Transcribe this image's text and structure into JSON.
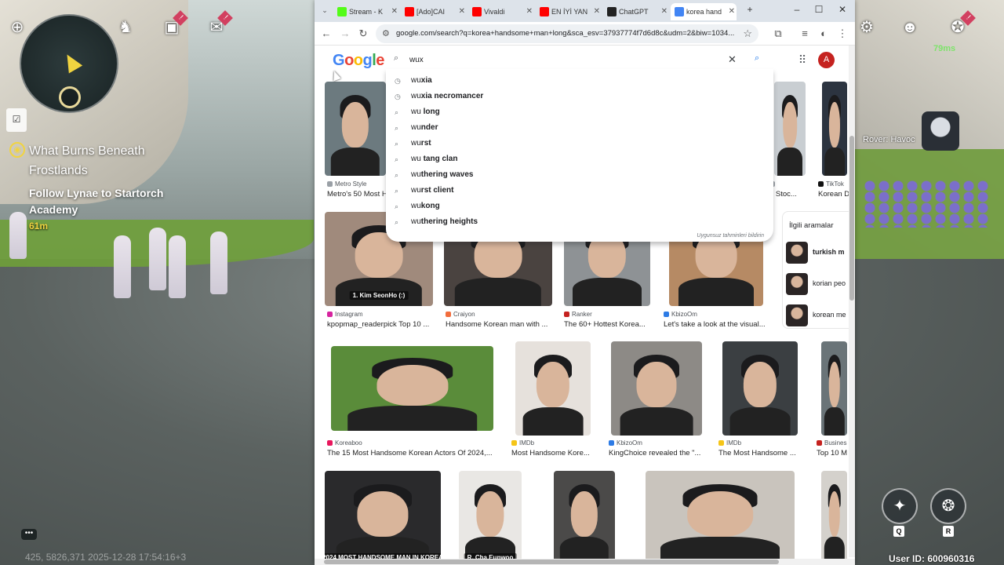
{
  "game": {
    "quest_title": "What Burns Beneath Frostlands",
    "quest_objective": "Follow Lynae to Startorch Academy",
    "quest_distance": "61m",
    "ping": "79ms",
    "character_name": "Rover: Havoc",
    "coords_time": "425, 5826,371   2025-12-28 17:54:16+3",
    "user_id": "User ID: 600960316",
    "skill_keys": [
      "Q",
      "R"
    ],
    "badge": "!"
  },
  "browser": {
    "tabs": [
      {
        "label": "Stream - K",
        "icon": "kick-icon",
        "color": "#53fc18"
      },
      {
        "label": "[Ado]CAI",
        "icon": "youtube-icon",
        "color": "#ff0000"
      },
      {
        "label": "Vivaldi",
        "icon": "youtube-icon",
        "color": "#ff0000"
      },
      {
        "label": "EN İYİ YAN",
        "icon": "youtube-icon",
        "color": "#ff0000"
      },
      {
        "label": "ChatGPT",
        "icon": "chatgpt-icon",
        "color": "#222222"
      },
      {
        "label": "korea hand",
        "icon": "google-icon",
        "color": "#4285f4",
        "active": true
      }
    ],
    "url": "google.com/search?q=korea+handsome+man+long&sca_esv=37937774f7d6d8c&udm=2&biw=1034..."
  },
  "google": {
    "logo": [
      "G",
      "o",
      "o",
      "g",
      "l",
      "e"
    ],
    "account_initial": "A",
    "query": "wux",
    "suggestions": [
      {
        "typed": "wu",
        "rest": "xia",
        "icon": "history-icon"
      },
      {
        "typed": "wu",
        "rest": "xia necromancer",
        "icon": "history-icon"
      },
      {
        "typed": "wu",
        "rest": " long",
        "icon": "search-icon"
      },
      {
        "typed": "wu",
        "rest": "nder",
        "icon": "search-icon"
      },
      {
        "typed": "wu",
        "rest": "rst",
        "icon": "search-icon"
      },
      {
        "typed": "wu",
        "rest": " tang clan",
        "icon": "search-icon"
      },
      {
        "typed": "wu",
        "rest": "thering waves",
        "icon": "search-icon"
      },
      {
        "typed": "wu",
        "rest": "rst client",
        "icon": "search-icon"
      },
      {
        "typed": "wu",
        "rest": "kong",
        "icon": "search-icon"
      },
      {
        "typed": "wu",
        "rest": "thering heights",
        "icon": "search-icon"
      }
    ],
    "suggestions_footer": "Uygunsuz tahminleri bildirin",
    "related_title": "İlgili aramalar",
    "related": [
      "turkish m",
      "korian peo",
      "korean me"
    ],
    "results": [
      {
        "source": "Metro Style",
        "title": "Metro's 50 Most H",
        "color": "#9aa0a6"
      },
      {
        "source": "TikTok",
        "title": "Korean D",
        "color": "#111111"
      },
      {
        "source": "",
        "title": "n Stoc...",
        "color": "#9aa0a6"
      },
      {
        "source": "Instagram",
        "title": "kpopmap_readerpick Top 10 ...",
        "color": "#d6249f",
        "caption": "1. Kim SeonHo (:)"
      },
      {
        "source": "Craiyon",
        "title": "Handsome Korean man with ...",
        "color": "#f26d3d"
      },
      {
        "source": "Ranker",
        "title": "The 60+ Hottest Korea...",
        "color": "#c5221f"
      },
      {
        "source": "KbizoOm",
        "title": "Let's take a look at the visual...",
        "color": "#2d7be5"
      },
      {
        "source": "Koreaboo",
        "title": "The 15 Most Handsome Korean Actors Of 2024,...",
        "color": "#e8175d"
      },
      {
        "source": "IMDb",
        "title": "Most Handsome Kore...",
        "color": "#f5c518"
      },
      {
        "source": "KbizoOm",
        "title": "KingChoice revealed the \"...",
        "color": "#2d7be5"
      },
      {
        "source": "IMDb",
        "title": "The Most Handsome ...",
        "color": "#f5c518"
      },
      {
        "source": "Busines",
        "title": "Top 10 M",
        "color": "#c5221f"
      }
    ],
    "bottom_captions": [
      "2024 MOST HANDSOME MAN IN KOREA",
      "R. Cha Eunwoo"
    ]
  }
}
